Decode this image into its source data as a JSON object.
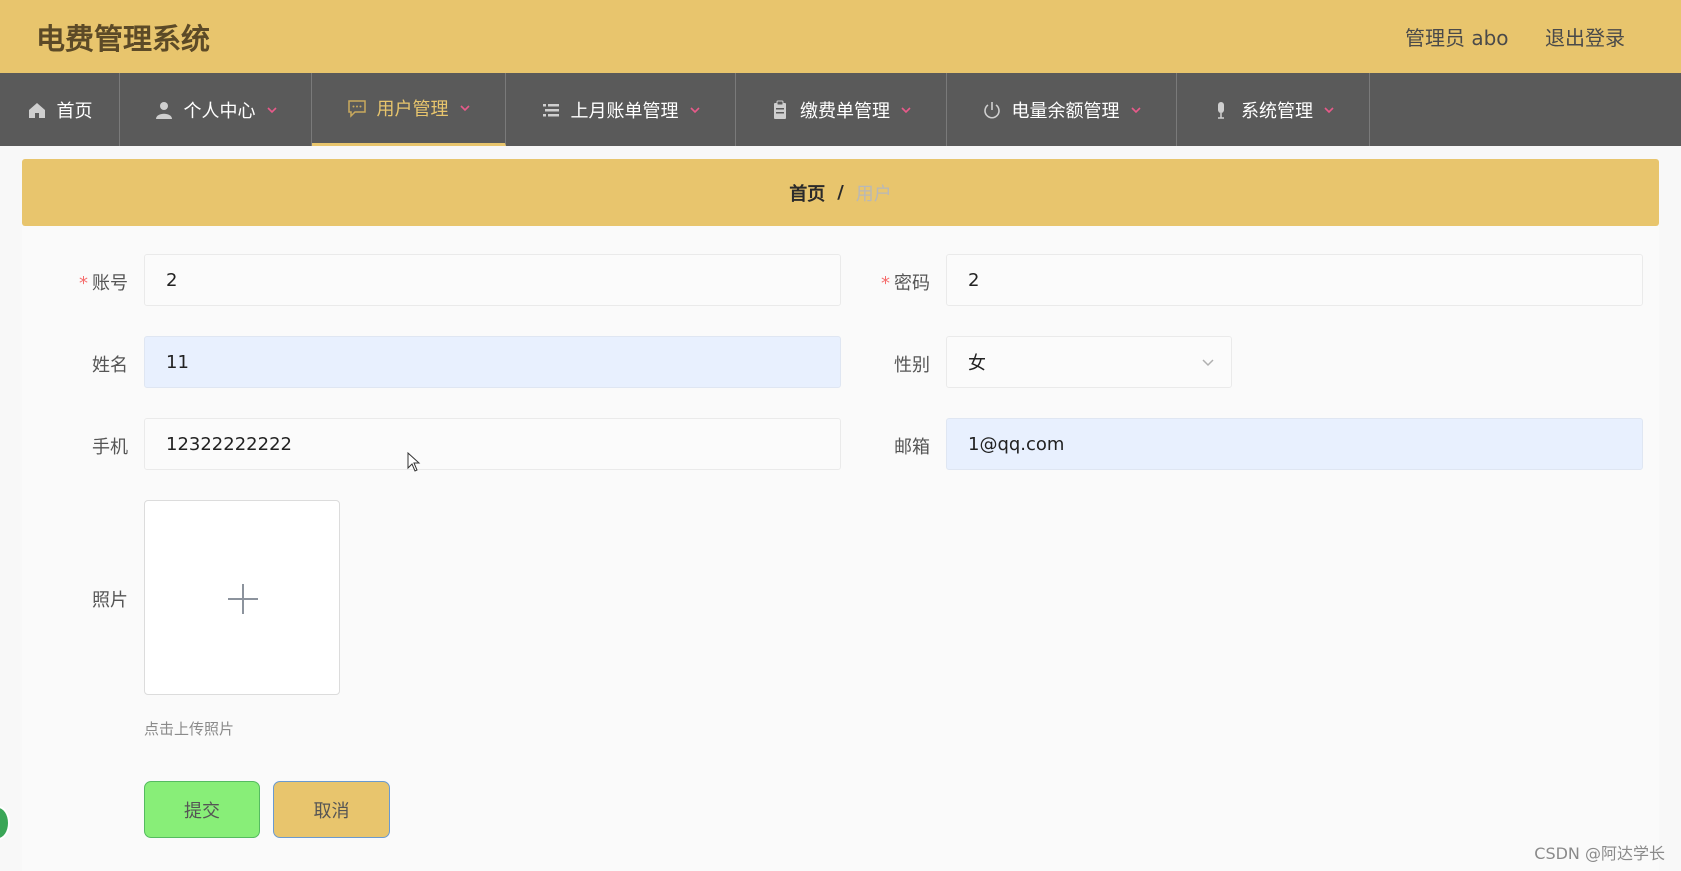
{
  "header": {
    "title": "电费管理系统",
    "user": "管理员 abo",
    "logout": "退出登录"
  },
  "nav": {
    "items": [
      {
        "label": "首页",
        "icon": "home-icon"
      },
      {
        "label": "个人中心",
        "icon": "person-icon"
      },
      {
        "label": "用户管理",
        "icon": "chat-icon"
      },
      {
        "label": "上月账单管理",
        "icon": "list-icon"
      },
      {
        "label": "缴费单管理",
        "icon": "clipboard-icon"
      },
      {
        "label": "电量余额管理",
        "icon": "power-icon"
      },
      {
        "label": "系统管理",
        "icon": "mic-icon"
      }
    ],
    "active_index": 2
  },
  "breadcrumb": {
    "home": "首页",
    "separator": "/",
    "current": "用户"
  },
  "form": {
    "account_label": "账号",
    "account_value": "2",
    "password_label": "密码",
    "password_value": "2",
    "name_label": "姓名",
    "name_value": "11",
    "gender_label": "性别",
    "gender_value": "女",
    "phone_label": "手机",
    "phone_value": "12322222222",
    "email_label": "邮箱",
    "email_value": "1@qq.com",
    "photo_label": "照片",
    "photo_hint": "点击上传照片",
    "required_mark": "*",
    "submit": "提交",
    "cancel": "取消"
  },
  "watermark": "CSDN @阿达学长",
  "colors": {
    "header_bg": "#e8c56d",
    "nav_bg": "#5a5a5a",
    "active_nav": "#e8c56d",
    "submit_bg": "#88ee78",
    "autofill_bg": "#e8f0fe",
    "required": "#f56c6c"
  }
}
